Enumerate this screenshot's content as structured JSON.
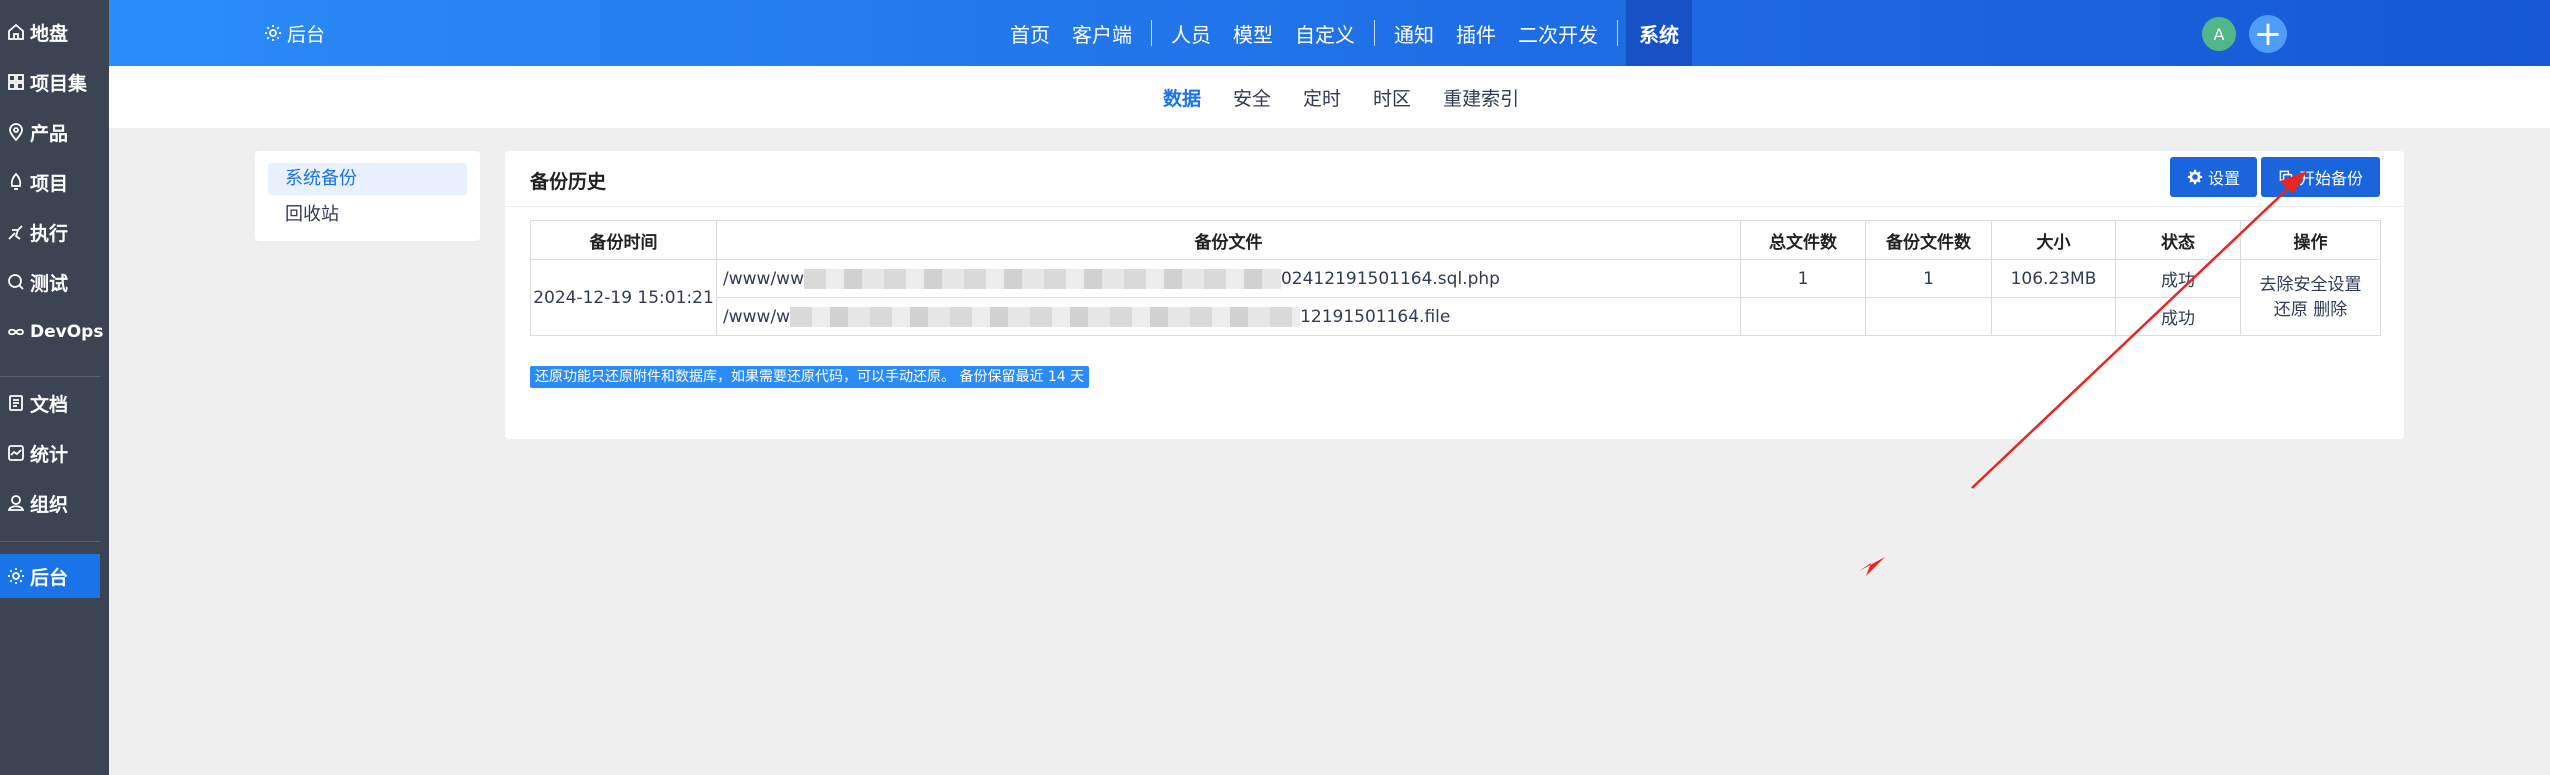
{
  "sidebar": {
    "items": [
      {
        "label": "地盘",
        "icon": "home-icon"
      },
      {
        "label": "项目集",
        "icon": "grid-icon"
      },
      {
        "label": "产品",
        "icon": "location-pin-icon"
      },
      {
        "label": "项目",
        "icon": "bell-icon"
      },
      {
        "label": "执行",
        "icon": "run-icon"
      },
      {
        "label": "测试",
        "icon": "search-icon"
      },
      {
        "label": "DevOps",
        "icon": "infinity-icon"
      },
      {
        "label": "文档",
        "icon": "document-icon"
      },
      {
        "label": "统计",
        "icon": "chart-icon"
      },
      {
        "label": "组织",
        "icon": "user-icon"
      },
      {
        "label": "后台",
        "icon": "gear-icon"
      }
    ]
  },
  "header": {
    "brand": "后台",
    "nav": [
      "首页",
      "客户端",
      "人员",
      "模型",
      "自定义",
      "通知",
      "插件",
      "二次开发",
      "系统"
    ],
    "active_nav": "系统",
    "avatar_letter": "A",
    "add_symbol": "+"
  },
  "subnav": {
    "tabs": [
      "数据",
      "安全",
      "定时",
      "时区",
      "重建索引"
    ],
    "active": "数据"
  },
  "menu": {
    "items": [
      "系统备份",
      "回收站"
    ],
    "active": "系统备份"
  },
  "card": {
    "title": "备份历史",
    "settings_button": "设置",
    "start_backup_button": "开始备份"
  },
  "table": {
    "headers": [
      "备份时间",
      "备份文件",
      "总文件数",
      "备份文件数",
      "大小",
      "状态",
      "操作"
    ],
    "row": {
      "time": "2024-12-19 15:01:21",
      "files": [
        {
          "prefix": "/www/ww",
          "suffix": "02412191501164.sql.php",
          "total": "1",
          "backed": "1",
          "size": "106.23MB",
          "status": "成功"
        },
        {
          "prefix": "/www/w",
          "suffix": "12191501164.file",
          "total": "",
          "backed": "",
          "size": "",
          "status": "成功"
        }
      ],
      "action_remove_safe": "去除安全设置",
      "action_restore": "还原",
      "action_delete": "删除"
    }
  },
  "notice": "还原功能只还原附件和数据库，如果需要还原代码，可以手动还原。 备份保留最近 14 天",
  "colors": {
    "primary": "#1a64dc",
    "sidebar": "#3c4353",
    "annotation_arrow": "#e8251f"
  }
}
